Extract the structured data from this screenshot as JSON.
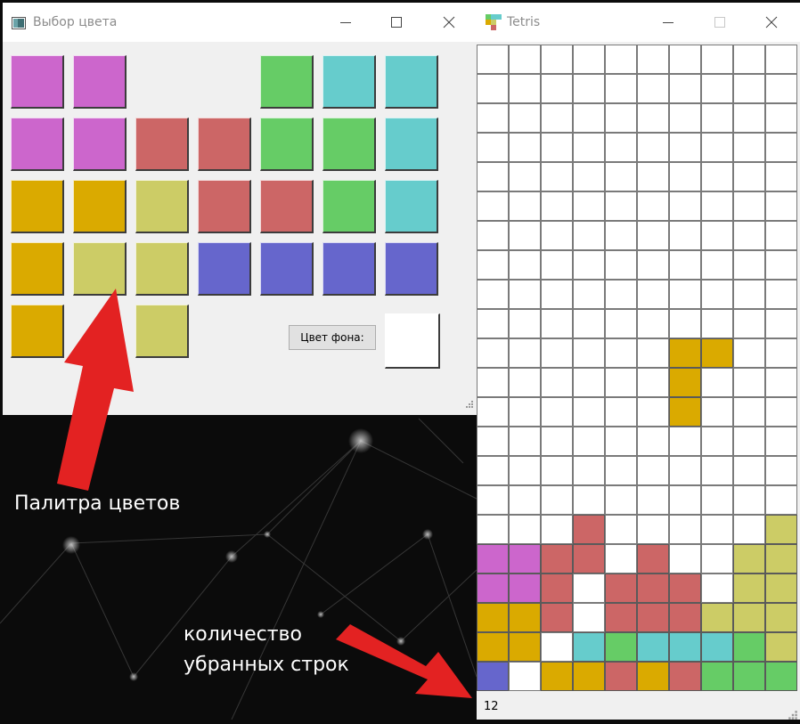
{
  "palette_window": {
    "title": "Выбор цвета",
    "icon": "window-app-icon",
    "controls": [
      "minimize-icon",
      "maximize-icon",
      "close-icon"
    ],
    "tiles": [
      {
        "color": "#cc66cc"
      },
      {
        "color": "#cc66cc"
      },
      {
        "color": "#66cc66"
      },
      {
        "color": "#66cccc"
      },
      {
        "color": "#66cccc"
      },
      {
        "color": "#cc66cc"
      },
      {
        "color": "#cc66cc"
      },
      {
        "color": "#cc6666"
      },
      {
        "color": "#cc6666"
      },
      {
        "color": "#66cc66"
      },
      {
        "color": "#66cc66"
      },
      {
        "color": "#66cccc"
      },
      {
        "color": "#daaa00"
      },
      {
        "color": "#daaa00"
      },
      {
        "color": "#cccc66"
      },
      {
        "color": "#cc6666"
      },
      {
        "color": "#cc6666"
      },
      {
        "color": "#66cc66"
      },
      {
        "color": "#66cccc"
      },
      {
        "color": "#daaa00"
      },
      {
        "color": "#cccc66"
      },
      {
        "color": "#cccc66"
      },
      {
        "color": "#6666cc"
      },
      {
        "color": "#6666cc"
      },
      {
        "color": "#6666cc"
      },
      {
        "color": "#6666cc"
      },
      {
        "color": "#daaa00"
      },
      {
        "color": "#cccc66"
      }
    ],
    "bg_button_label": "Цвет фона:",
    "bg_color": "#ffffff"
  },
  "tetris_window": {
    "title": "Tetris",
    "icon": "tetris-app-icon",
    "controls": [
      "minimize-icon",
      "maximize-icon",
      "close-icon"
    ],
    "board": {
      "cols": 10,
      "rows": 22,
      "legend": {
        "M": "#cc66cc",
        "R": "#cc6666",
        "O": "#daaa00",
        "Y": "#cccc66",
        "C": "#66cccc",
        "G": "#66cc66",
        "B": "#6666cc"
      },
      "occupied": [
        {
          "row": 10,
          "cells": "......OO.."
        },
        {
          "row": 11,
          "cells": "......O..."
        },
        {
          "row": 12,
          "cells": "......O..."
        },
        {
          "row": 16,
          "cells": "...R.....Y"
        },
        {
          "row": 17,
          "cells": "MMRR.R..YY"
        },
        {
          "row": 18,
          "cells": "MMR.RRR.YY"
        },
        {
          "row": 19,
          "cells": "OOR.RRRYYY"
        },
        {
          "row": 20,
          "cells": "OO.CGCCCGY"
        },
        {
          "row": 21,
          "cells": "B.OORORGGG"
        }
      ]
    },
    "cleared_rows": "12"
  },
  "annotations": {
    "palette_caption": "Палитра цветов",
    "rows_caption_line1": "количество",
    "rows_caption_line2": "убранных строк",
    "arrow_color": "#e32222"
  }
}
